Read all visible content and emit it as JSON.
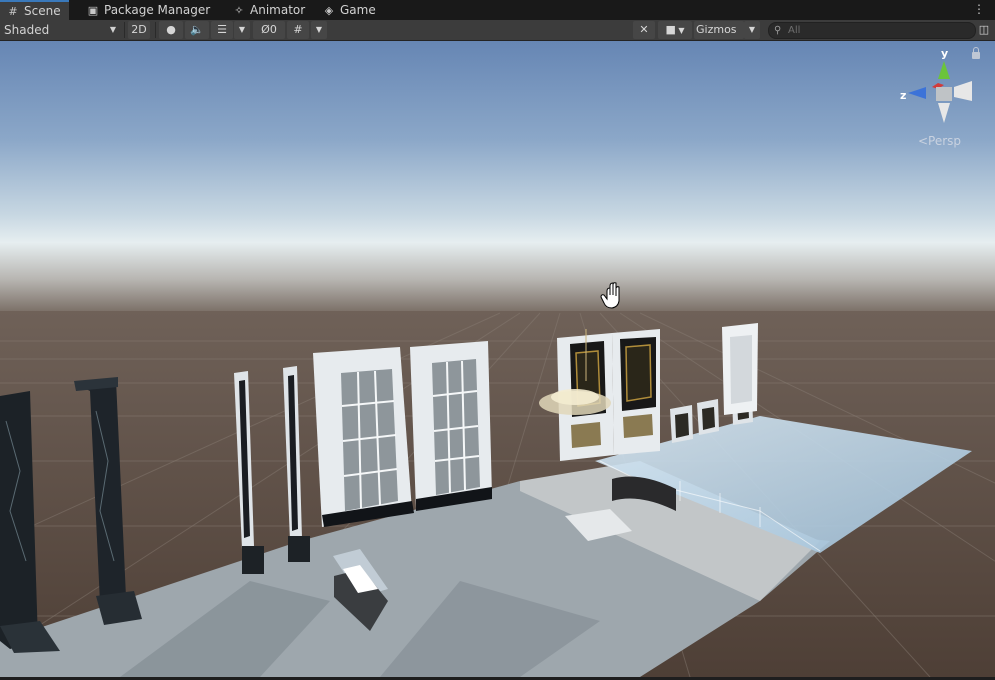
{
  "tabs": [
    {
      "label": "Scene",
      "icon": "grid-icon",
      "active": true
    },
    {
      "label": "Package Manager",
      "icon": "package-icon",
      "active": false
    },
    {
      "label": "Animator",
      "icon": "animator-icon",
      "active": false
    },
    {
      "label": "Game",
      "icon": "gamepad-icon",
      "active": false
    }
  ],
  "toolbar": {
    "draw_mode": "Shaded",
    "mode_2d": "2D",
    "hidden_count": "0",
    "gizmos_label": "Gizmos",
    "search_placeholder": "All"
  },
  "gizmo": {
    "y_label": "y",
    "z_label": "z",
    "projection_label": "<Persp"
  },
  "colors": {
    "tab_active_accent": "#3a79bb",
    "sky_top": "#6c8cb8",
    "horizon": "#e3ecef",
    "ground": "#5a4a40",
    "axis_y": "#6bc43a",
    "axis_z": "#3c73d8",
    "axis_x": "#d23b3b"
  }
}
